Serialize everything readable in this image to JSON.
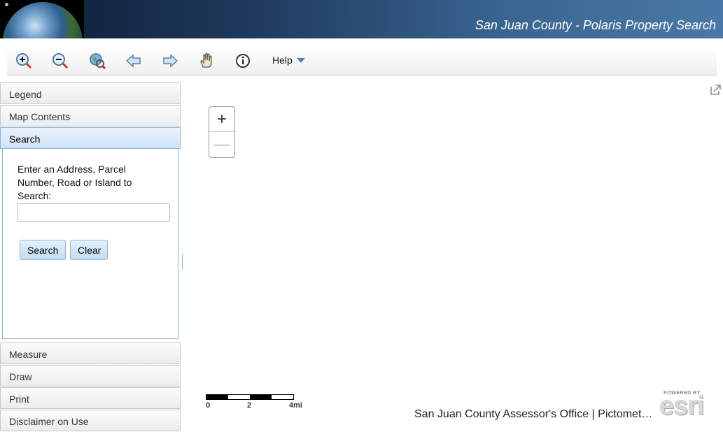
{
  "header": {
    "title": "San Juan County - Polaris Property Search"
  },
  "toolbar": {
    "tools": [
      "zoom-in-icon",
      "zoom-out-icon",
      "full-extent-icon",
      "previous-extent-icon",
      "next-extent-icon",
      "pan-icon",
      "identify-icon"
    ],
    "help_label": "Help"
  },
  "sidebar": {
    "panels": [
      "Legend",
      "Map Contents",
      "Search",
      "Measure",
      "Draw",
      "Print",
      "Disclaimer on Use"
    ],
    "active_panel": "Search",
    "search": {
      "prompt": "Enter an Address, Parcel Number, Road or Island to Search:",
      "input_value": "",
      "search_button": "Search",
      "clear_button": "Clear"
    }
  },
  "map": {
    "zoom_in": "+",
    "zoom_out": "—",
    "scalebar": {
      "labels": [
        "0",
        "2",
        "4mi"
      ]
    },
    "attribution": "San Juan County Assessor's Office | Pictomet…",
    "esri_small": "POWERED BY",
    "esri_word": "esri"
  },
  "colors": {
    "header_dark": "#0b1b33",
    "header_light": "#4a78a6",
    "accent": "#8fb4d9"
  }
}
